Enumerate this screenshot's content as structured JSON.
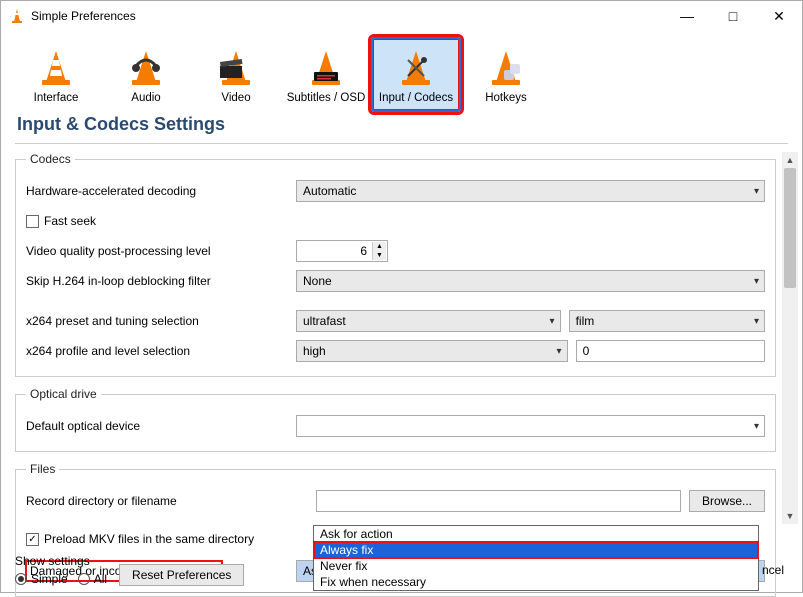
{
  "window": {
    "title": "Simple Preferences"
  },
  "tabs": {
    "interface": "Interface",
    "audio": "Audio",
    "video": "Video",
    "subtitles": "Subtitles / OSD",
    "inputcodecs": "Input / Codecs",
    "hotkeys": "Hotkeys"
  },
  "section_title": "Input & Codecs Settings",
  "codecs": {
    "legend": "Codecs",
    "hw_decoding_label": "Hardware-accelerated decoding",
    "hw_decoding_value": "Automatic",
    "fast_seek_label": "Fast seek",
    "vqpp_label": "Video quality post-processing level",
    "vqpp_value": "6",
    "skip_h264_label": "Skip H.264 in-loop deblocking filter",
    "skip_h264_value": "None",
    "x264_preset_label": "x264 preset and tuning selection",
    "x264_preset_value": "ultrafast",
    "x264_tuning_value": "film",
    "x264_profile_label": "x264 profile and level selection",
    "x264_profile_value": "high",
    "x264_level_value": "0"
  },
  "optical": {
    "legend": "Optical drive",
    "default_label": "Default optical device"
  },
  "files": {
    "legend": "Files",
    "record_label": "Record directory or filename",
    "browse_label": "Browse...",
    "preload_mkv_label": "Preload MKV files in the same directory",
    "avi_label": "Damaged or incomplete AVI file",
    "avi_value": "Ask for action",
    "avi_options": [
      "Ask for action",
      "Always fix",
      "Never fix",
      "Fix when necessary"
    ]
  },
  "footer": {
    "show_settings_label": "Show settings",
    "simple_label": "Simple",
    "all_label": "All",
    "reset_label": "Reset Preferences",
    "cancel_tail": "ncel"
  }
}
